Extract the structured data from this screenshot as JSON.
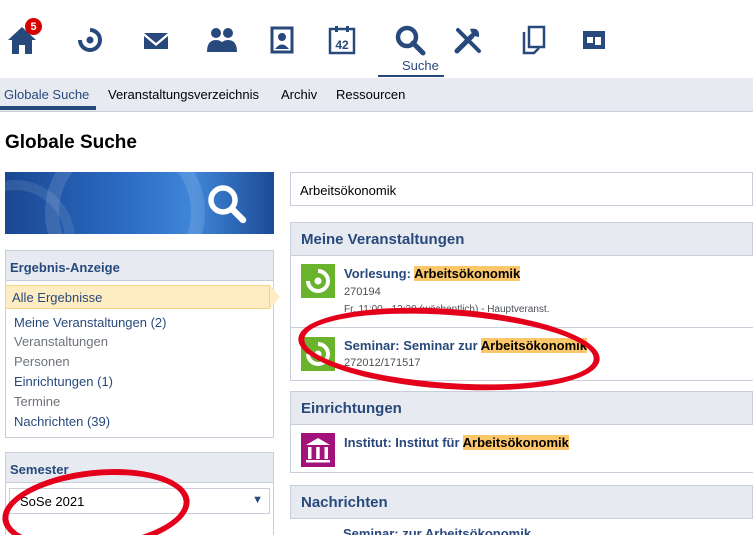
{
  "topbar": {
    "icons": [
      "home-icon",
      "activity-icon",
      "mail-icon",
      "community-icon",
      "profile-icon",
      "calendar-icon",
      "search-icon",
      "tools-icon",
      "files-icon",
      "admin-icon"
    ],
    "notification_count": "5",
    "calendar_day": "42",
    "active_label": "Suche"
  },
  "nav": {
    "tabs": [
      "Globale Suche",
      "Veranstaltungsverzeichnis",
      "Archiv",
      "Ressourcen"
    ],
    "active_index": 0
  },
  "page": {
    "title": "Globale Suche"
  },
  "sidebar": {
    "results_heading": "Ergebnis-Anzeige",
    "items": [
      {
        "label": "Alle Ergebnisse",
        "state": "active"
      },
      {
        "label": "Meine Veranstaltungen (2)",
        "state": "link"
      },
      {
        "label": "Veranstaltungen",
        "state": "muted"
      },
      {
        "label": "Personen",
        "state": "muted"
      },
      {
        "label": "Einrichtungen (1)",
        "state": "link"
      },
      {
        "label": "Termine",
        "state": "muted"
      },
      {
        "label": "Nachrichten (39)",
        "state": "link"
      }
    ],
    "semester_heading": "Semester",
    "semester_value": "SoSe 2021"
  },
  "search": {
    "query": "Arbeitsökonomik"
  },
  "sections": {
    "my_courses": {
      "title": "Meine Veranstaltungen",
      "results": [
        {
          "prefix": "Vorlesung: ",
          "highlight": "Arbeitsökonomik",
          "number": "270194",
          "time": "Fr. 11:00 - 12:30 (wöchentlich) - Hauptveranst."
        },
        {
          "prefix": "Seminar: Seminar zur ",
          "highlight": "Arbeitsökonomik",
          "number": "272012/171517"
        }
      ]
    },
    "institutions": {
      "title": "Einrichtungen",
      "results": [
        {
          "prefix": "Institut: Institut für ",
          "highlight": "Arbeitsökonomik"
        }
      ]
    },
    "messages": {
      "title": "Nachrichten",
      "partial": "Seminar: zur Arbeitsökonomik"
    }
  },
  "colors": {
    "brand": "#28497c",
    "highlight": "#fbc76a",
    "course_icon": "#6ab42d",
    "institute_icon": "#a3127a",
    "annotation": "#e4001b"
  }
}
